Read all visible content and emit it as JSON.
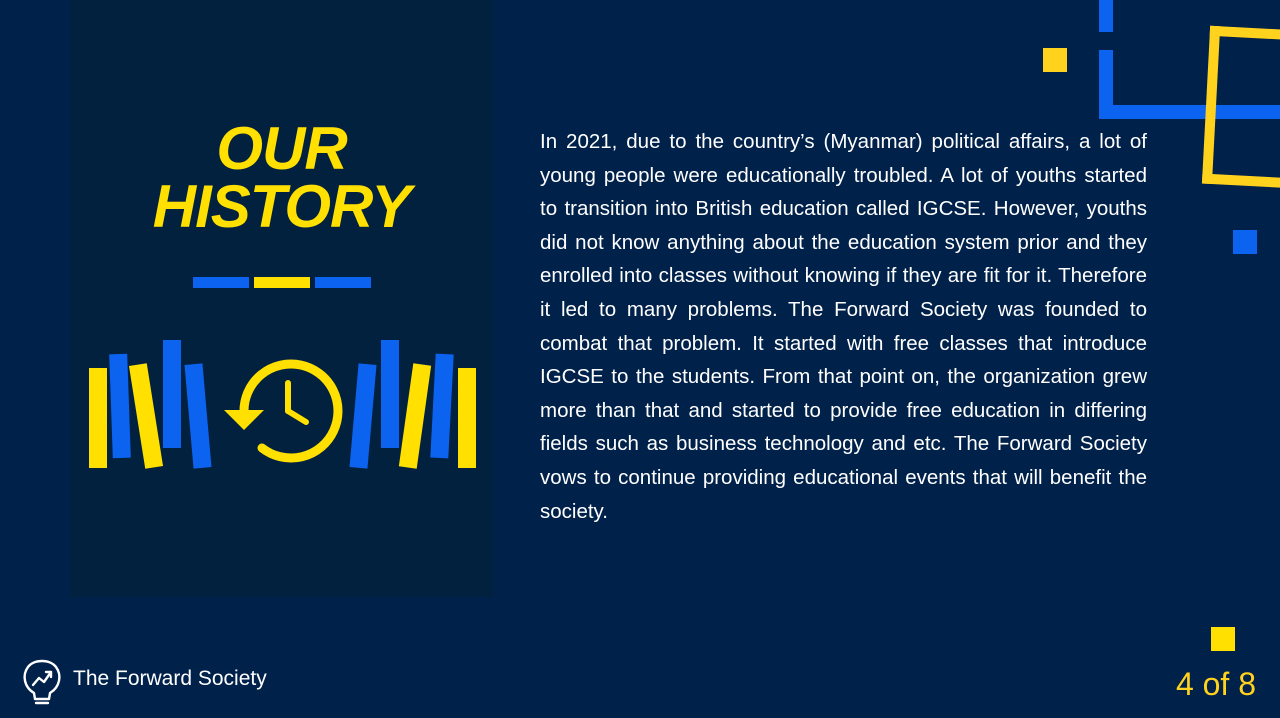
{
  "slide": {
    "title_line1": "OUR",
    "title_line2": "HISTORY",
    "body": "In 2021, due to the country’s (Myanmar) political affairs, a lot of young people were educationally troubled. A lot of youths started to transition into British education called IGCSE. However, youths did not know anything about the education system prior and they enrolled into classes without knowing if they are fit for it. Therefore it led to many problems. The Forward Society was founded to combat that problem. It started with free classes that introduce IGCSE to the students. From that point on, the organization grew more than that and started to provide free education in differing fields such as business technology and etc. The Forward Society vows to continue providing educational events that will benefit the society."
  },
  "footer": {
    "org_name": "The Forward Society",
    "page_indicator": "4 of 8",
    "logo_icon": "lightbulb-growth-icon"
  },
  "colors": {
    "background": "#00214a",
    "panel": "#02213f",
    "yellow": "#ffe000",
    "blue": "#0b63f0",
    "text": "#ffffff"
  },
  "icons": {
    "history": "history-clock-icon",
    "books": "book-spines-icon"
  }
}
